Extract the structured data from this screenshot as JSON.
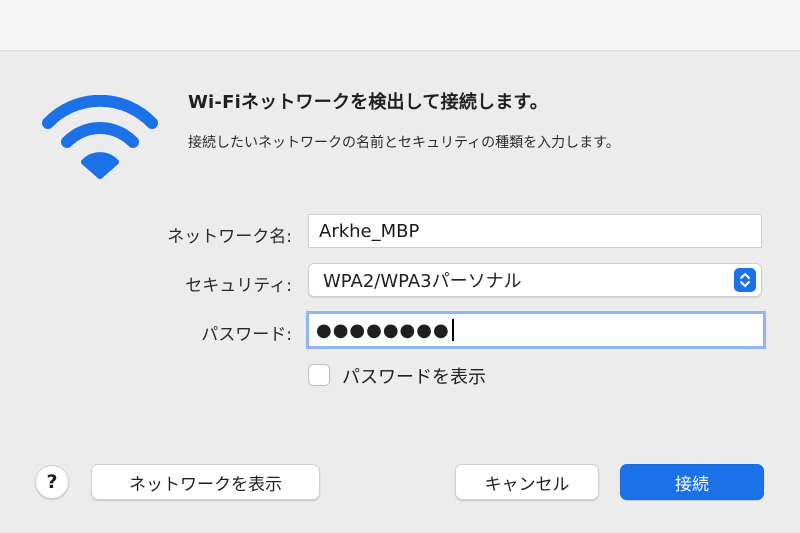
{
  "dialog": {
    "heading": "Wi-Fiネットワークを検出して接続します。",
    "subheading": "接続したいネットワークの名前とセキュリティの種類を入力します。",
    "icon": "wifi-icon",
    "accent_color": "#1b72e8"
  },
  "form": {
    "network_name_label": "ネットワーク名:",
    "network_name_value": "Arkhe_MBP",
    "security_label": "セキュリティ:",
    "security_value": "WPA2/WPA3パーソナル",
    "password_label": "パスワード:",
    "password_masked": "●●●●●●●●",
    "show_password_label": "パスワードを表示",
    "show_password_checked": false
  },
  "buttons": {
    "help_label": "?",
    "show_networks_label": "ネットワークを表示",
    "cancel_label": "キャンセル",
    "connect_label": "接続"
  }
}
